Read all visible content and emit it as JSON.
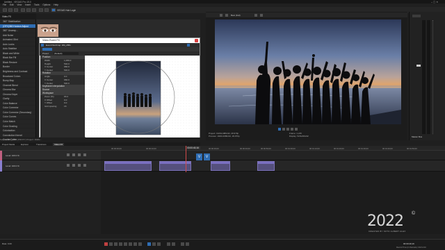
{
  "window": {
    "title": "Untitled - VEGAS Pro 19.0"
  },
  "menu": [
    "File",
    "Edit",
    "View",
    "Insert",
    "Tools",
    "Options",
    "Help"
  ],
  "toolbar": {
    "label": "VEGAS Hub Login"
  },
  "fx_panel": {
    "header": "Video FX",
    "items": [
      "360° Stabilization",
      "(OFX)360 Horizon Adjust",
      "360° Unwrap...",
      "Add Noise",
      "Animated Glint",
      "Auto Looks",
      "Auto Stabilize",
      "Black and White",
      "Black Bar Fill",
      "Black Restore",
      "Border",
      "Brightness and Contrast",
      "Broadcast Colors",
      "Bump Map",
      "Channel Blend",
      "Chroma Blur",
      "Chroma Keyer",
      "Clarity",
      "Color Balance",
      "Color Corrector",
      "Color Corrector (Secondary)",
      "Color Curves",
      "Color Match",
      "Color Grading",
      "Colorization",
      "Convolution Kernel",
      "Cookie Cutter",
      "Crop",
      "Deform"
    ],
    "selected_index": 1
  },
  "dialog": {
    "title": "Video Event FX",
    "subtitle": "Event Pan/Crop: DM_2651",
    "preset_label": "Preset:",
    "preset_value": "(Default)",
    "sections": [
      {
        "name": "Position",
        "rows": [
          {
            "label": "Width",
            "value": "1,056.0"
          },
          {
            "label": "Height",
            "value": "594.0"
          },
          {
            "label": "X Center",
            "value": "960.0"
          },
          {
            "label": "Y Center",
            "value": "540.0"
          }
        ]
      },
      {
        "name": "Rotation",
        "rows": [
          {
            "label": "Angle",
            "value": "0.0"
          },
          {
            "label": "X Center",
            "value": "960.0"
          },
          {
            "label": "Y Center",
            "value": "540.0"
          }
        ]
      },
      {
        "name": "Keyframe interpolation",
        "rows": []
      },
      {
        "name": "Source",
        "rows": []
      },
      {
        "name": "Workspace",
        "rows": [
          {
            "label": "Zoom (%)",
            "value": "93.4"
          },
          {
            "label": "X Offset",
            "value": "0.0"
          },
          {
            "label": "Y Offset",
            "value": "0.0"
          },
          {
            "label": "Grid spacing",
            "value": "16"
          }
        ]
      }
    ]
  },
  "preview": {
    "quality": "Best (Full)",
    "project": "Project: 1920x1080x32, 29.970p",
    "preview_res": "Preview: 1920x1080x32, 29.970p",
    "frame": "Frame: 1,215",
    "display": "Display: 520x293x32"
  },
  "left_status": "Source: DM_2651 (PROXY) Project: 1920x...",
  "tab_labels": [
    "Project Media",
    "Explorer",
    "Transitions",
    "Video FX"
  ],
  "timeline": {
    "time_readout": "00:00:40;16",
    "markers": [
      "00:00:00;00",
      "00:00:10;00",
      "00:00:20;00",
      "00:00:30;00",
      "00:00:40;00",
      "00:00:50;00",
      "00:01:00;00",
      "00:01:10;00",
      "00:01:20;00",
      "00:01:30;00",
      "00:01:40;00",
      "00:01:50;00"
    ],
    "tracks": [
      {
        "label": "Level: 100.0 %"
      },
      {
        "label": "Level: 100.0 %"
      }
    ]
  },
  "bottom": {
    "rate": "Rate: 0.00",
    "time": "00:00:40;16",
    "record_time": "Record Time (2 channels): 152:14:40"
  },
  "meters": {
    "label": "Master Bus"
  },
  "watermark": {
    "year": "2022",
    "sub": "CREATED BY SOTO ALBERT ALEX"
  },
  "colors": {
    "accent": "#2f6db3",
    "clip": "#55507d",
    "playhead": "#d24a4a"
  }
}
